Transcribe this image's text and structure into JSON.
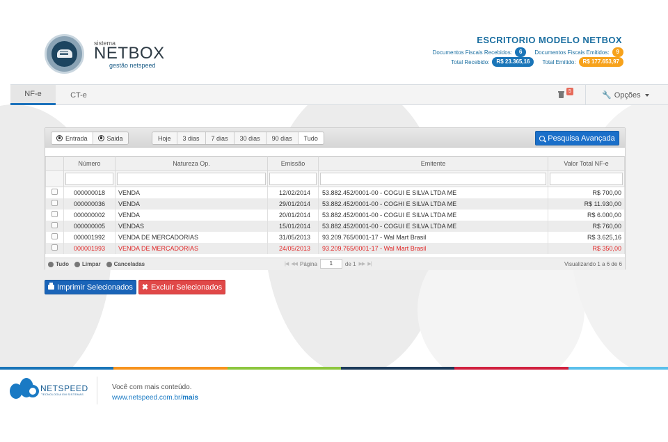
{
  "header": {
    "brand_small": "sistema",
    "brand_name": "NETBOX",
    "brand_tag": "gestão netspeed",
    "office_name": "ESCRITORIO MODELO NETBOX",
    "docs_received_label": "Documentos Fiscais Recebidos:",
    "docs_received_count": "6",
    "docs_emitted_label": "Documentos Fiscais Emitidos:",
    "docs_emitted_count": "9",
    "total_received_label": "Total Recebido:",
    "total_received_value": "R$ 23.365,16",
    "total_emitted_label": "Total Emitido:",
    "total_emitted_value": "R$ 177.653,97"
  },
  "tabs": {
    "nfe": "NF-e",
    "cte": "CT-e",
    "trash_count": "5",
    "options": "Opções"
  },
  "toolbar": {
    "entrada": "Entrada",
    "saida": "Saida",
    "periods": [
      "Hoje",
      "3 dias",
      "7 dias",
      "30 dias",
      "90 dias",
      "Tudo"
    ],
    "search_button": "Pesquisa Avançada"
  },
  "table": {
    "columns": [
      "Número",
      "Natureza Op.",
      "Emissão",
      "Emitente",
      "Valor Total NF-e"
    ],
    "rows": [
      {
        "numero": "000000018",
        "natureza": "VENDA",
        "emissao": "12/02/2014",
        "emitente": "53.882.452/0001-00 - COGUI E SILVA LTDA ME",
        "valor": "R$ 700,00"
      },
      {
        "numero": "000000036",
        "natureza": "VENDA",
        "emissao": "29/01/2014",
        "emitente": "53.882.452/0001-00 - COGHI E SILVA LTDA ME",
        "valor": "R$ 11.930,00"
      },
      {
        "numero": "000000002",
        "natureza": "VENDA",
        "emissao": "20/01/2014",
        "emitente": "53.882.452/0001-00 - COGUI E SILVA LTDA ME",
        "valor": "R$ 6.000,00"
      },
      {
        "numero": "000000005",
        "natureza": "VENDAS",
        "emissao": "15/01/2014",
        "emitente": "53.882.452/0001-00 - COGUI E SILVA LTDA ME",
        "valor": "R$ 760,00"
      },
      {
        "numero": "000001992",
        "natureza": "VENDA DE MERCADORIAS",
        "emissao": "31/05/2013",
        "emitente": "93.209.765/0001-17 - Wal Mart Brasil",
        "valor": "R$ 3.625,16"
      },
      {
        "numero": "000001993",
        "natureza": "VENDA DE MERCADORIAS",
        "emissao": "24/05/2013",
        "emitente": "93.209.765/0001-17 - Wal Mart Brasil",
        "valor": "R$ 350,00"
      }
    ]
  },
  "footer_bar": {
    "tudo": "Tudo",
    "limpar": "Limpar",
    "canceladas": "Canceladas",
    "page_label": "Página",
    "page_value": "1",
    "of_label": "de 1",
    "summary": "Visualizando 1 a 6 de 6"
  },
  "actions": {
    "print": "Imprimir Selecionados",
    "delete": "Excluir Selecionados"
  },
  "site_footer": {
    "logo_name": "NETSPEED",
    "logo_sub": "TECNOLOGIA EM SISTEMAS",
    "tagline": "Você com mais conteúdo.",
    "link_prefix": "www.netspeed.com.br/",
    "link_bold": "mais"
  },
  "colors": {
    "accent_blue": "#1a6fc9",
    "danger_red": "#e04848",
    "badge_orange": "#f7a21b",
    "strip": [
      "#1a75b8",
      "#f7931e",
      "#8dc63f",
      "#1d3b5a",
      "#d0213f",
      "#5bc0eb"
    ]
  }
}
